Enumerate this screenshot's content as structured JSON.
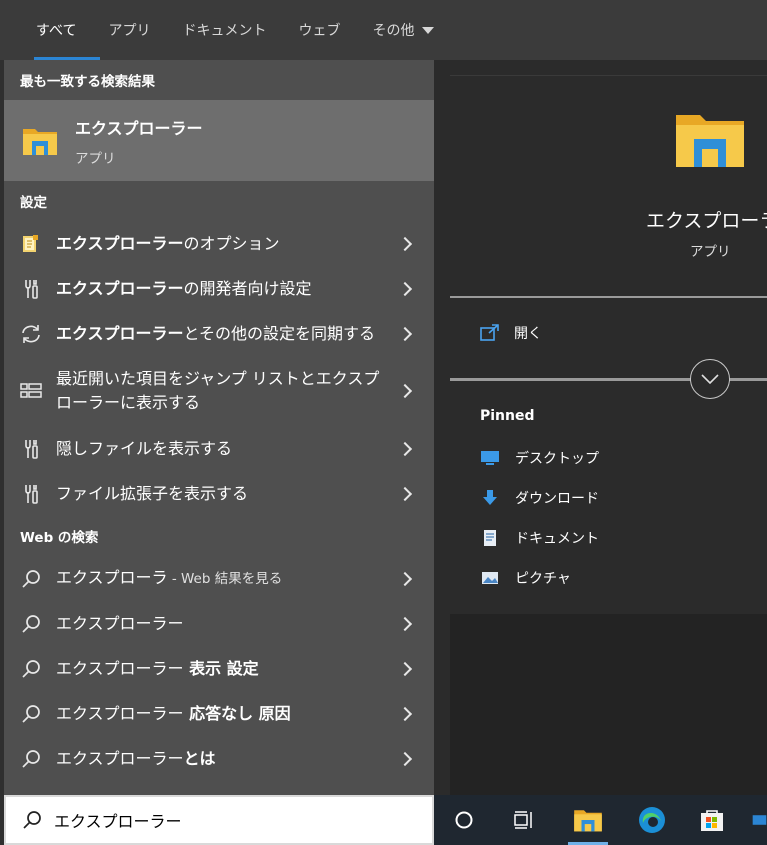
{
  "tabs": [
    {
      "label": "すべて"
    },
    {
      "label": "アプリ"
    },
    {
      "label": "ドキュメント"
    },
    {
      "label": "ウェブ"
    },
    {
      "label": "その他"
    }
  ],
  "best_match": {
    "header": "最も一致する検索結果",
    "name": "エクスプローラー",
    "type": "アプリ"
  },
  "settings": {
    "header": "設定",
    "items": [
      {
        "bold": "エクスプローラー",
        "rest": "のオプション"
      },
      {
        "bold": "エクスプローラー",
        "rest": "の開発者向け設定"
      },
      {
        "bold": "エクスプローラー",
        "rest": "とその他の設定を同期する"
      },
      {
        "bold": "",
        "rest": "最近開いた項目をジャンプ リストとエクスプローラーに表示する"
      },
      {
        "bold": "",
        "rest": "隠しファイルを表示する"
      },
      {
        "bold": "",
        "rest": "ファイル拡張子を表示する"
      }
    ]
  },
  "web": {
    "header": "Web の検索",
    "items": [
      {
        "normal": "エクスプローラ",
        "suffix": " - Web 結果を見る"
      },
      {
        "normal": "エクスプローラー",
        "suffix": ""
      },
      {
        "normal": "エクスプローラー",
        "suffix": " 表示 設定"
      },
      {
        "normal": "エクスプローラー",
        "suffix": " 応答なし 原因"
      },
      {
        "normal": "エクスプローラー",
        "suffix": "とは"
      }
    ]
  },
  "detail": {
    "title": "エクスプローラー",
    "subtitle": "アプリ",
    "open_label": "開く",
    "pinned_header": "Pinned",
    "pinned": [
      {
        "label": "デスクトップ",
        "icon": "desktop-icon"
      },
      {
        "label": "ダウンロード",
        "icon": "download-icon"
      },
      {
        "label": "ドキュメント",
        "icon": "document-icon"
      },
      {
        "label": "ピクチャ",
        "icon": "picture-icon"
      }
    ]
  },
  "search": {
    "value": "エクスプローラー"
  },
  "colors": {
    "accent": "#2b85d4",
    "folder": "#f4c542"
  }
}
